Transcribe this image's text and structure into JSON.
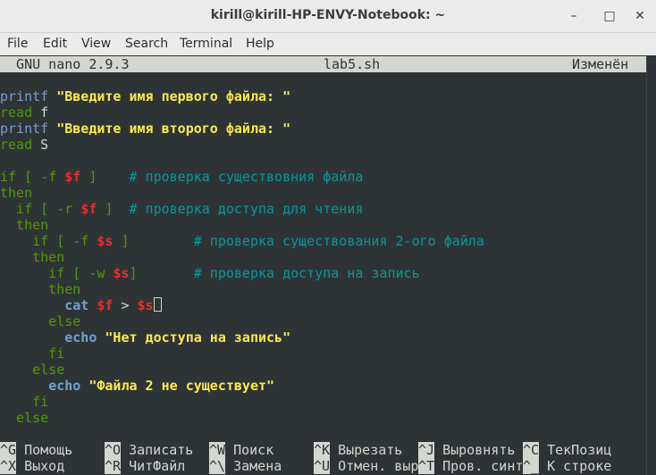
{
  "window": {
    "title": "kirill@kirill-HP-ENVY-Notebook: ~",
    "minimize": "–",
    "maximize": "□",
    "close": "✕"
  },
  "menu": [
    "File",
    "Edit",
    "View",
    "Search",
    "Terminal",
    "Help"
  ],
  "nano": {
    "version": "  GNU nano 2.9.3",
    "filename": "lab5.sh",
    "status": "Изменён"
  },
  "code": {
    "l1_kw": "printf",
    "l1_str": "\"Введите имя первого файла: \"",
    "l2_kw": "read",
    "l2_arg": " f",
    "l3_kw": "printf",
    "l3_str": "\"Введите имя второго файла: \"",
    "l4_kw": "read",
    "l4_arg": " S",
    "l6_a": "if [ -f ",
    "l6_var": "$f",
    "l6_b": " ]",
    "l6_cmt": "# проверка существовния файла",
    "l7": "then",
    "l8_a": "  if [ -r ",
    "l8_var": "$f",
    "l8_b": " ]",
    "l8_cmt": "# проверка доступа для чтения",
    "l9": "  then",
    "l10_a": "    if [ -f ",
    "l10_var": "$s",
    "l10_b": " ]",
    "l10_cmt": "# проверка существования 2-ого файла",
    "l11": "    then",
    "l12_a": "      if [ -w ",
    "l12_var": "$s",
    "l12_b": "]",
    "l12_cmt": "# проверка доступа на запись",
    "l13": "      then",
    "l14_kw": "cat",
    "l14_var1": "$f",
    "l14_op": " > ",
    "l14_var2": "$s",
    "l15": "      else",
    "l16_kw": "echo",
    "l16_str": "\"Нет доступа на запись\"",
    "l17": "      fi",
    "l18": "    else",
    "l19_kw": "echo",
    "l19_str": "\"Файла 2 не существует\"",
    "l20": "    fi",
    "l21": "  else"
  },
  "shortcuts": {
    "row1": [
      {
        "key": "^G",
        "label": " Помощь"
      },
      {
        "key": "^O",
        "label": " Записать"
      },
      {
        "key": "^W",
        "label": " Поиск"
      },
      {
        "key": "^K",
        "label": " Вырезать"
      },
      {
        "key": "^J",
        "label": " Выровнять"
      },
      {
        "key": "^C",
        "label": " ТекПозиц"
      }
    ],
    "row2": [
      {
        "key": "^X",
        "label": " Выход"
      },
      {
        "key": "^R",
        "label": " ЧитФайл"
      },
      {
        "key": "^\\",
        "label": " Замена"
      },
      {
        "key": "^U",
        "label": " Отмен. выр"
      },
      {
        "key": "^T",
        "label": " Пров. синт"
      },
      {
        "key": "^_",
        "label": " К строке"
      }
    ]
  }
}
